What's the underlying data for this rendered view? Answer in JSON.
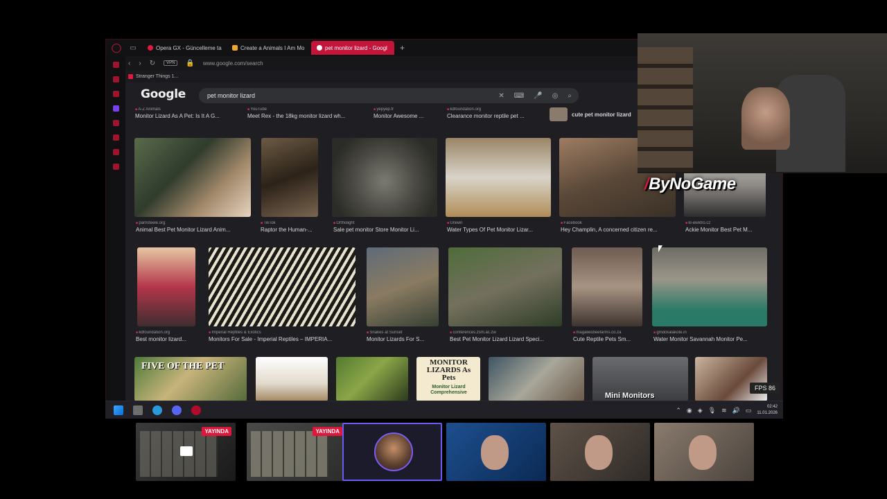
{
  "browser": {
    "tabs": [
      {
        "label": "Opera GX - Güncelleme ta",
        "active": false
      },
      {
        "label": "Create a Animals I Am Mo",
        "active": false
      },
      {
        "label": "pet monitor lizard - Googl",
        "active": true
      }
    ],
    "vpn_label": "VPN",
    "url": "www.google.com/search",
    "bookmark": "Stranger Things 1..."
  },
  "google": {
    "logo": "Google",
    "query": "pet monitor lizard",
    "top_captions": [
      {
        "source": "A-Z Animals",
        "title": "Monitor Lizard As A Pet: Is It A G..."
      },
      {
        "source": "YouTube",
        "title": "Meet Rex - the 18kg monitor lizard wh..."
      },
      {
        "source": "yepyep.fr",
        "title": "Monitor Awesome ..."
      },
      {
        "source": "kdfoundation.org",
        "title": "Clearance monitor reptile pet ..."
      }
    ],
    "related_chip": "cute pet monitor lizard",
    "row1": [
      {
        "source": "pamsteele.org",
        "title": "Animal Best Pet Monitor Lizard Anim..."
      },
      {
        "source": "TikTok",
        "title": "Raptor the Human-..."
      },
      {
        "source": "Ortholight",
        "title": "Sale pet monitor Store Monitor Li..."
      },
      {
        "source": "Uniwin",
        "title": "Water Types Of Pet Monitor Lizar..."
      },
      {
        "source": "Facebook",
        "title": "Hey Champlin, A concerned citizen re..."
      },
      {
        "source": "kl-elektro.cz",
        "title": "Ackie Monitor Best Pet M..."
      }
    ],
    "row2": [
      {
        "source": "kdfoundation.org",
        "title": "Best monitor lizard..."
      },
      {
        "source": "Imperial Reptiles & Exotics",
        "title": "Monitors For Sale - Imperial Reptiles – IMPERIA..."
      },
      {
        "source": "Snakes at Sunset",
        "title": "Monitor Lizards For S..."
      },
      {
        "source": "conferences.zsm.ac.zw",
        "title": "Best Pet Monitor Lizard Lizard Speci..."
      },
      {
        "source": "magaliesbeefarms.co.za",
        "title": "Cute Reptile Pets Sm..."
      },
      {
        "source": "gmdckalakote.in",
        "title": "Water Monitor Savannah Monitor Pe..."
      }
    ],
    "row3_texts": {
      "five": "FIVE OF THE PET",
      "book_title": "MONITOR LIZARDS As Pets",
      "book_sub": "Monitor Lizard Comprehensive",
      "mini": "Mini Monitors"
    }
  },
  "overlay": {
    "fps": "FPS 86",
    "brand": "ByNoGame",
    "live_label": "YAYINDA"
  },
  "taskbar": {
    "time": "02:42",
    "date": "11.01.2026"
  },
  "colors": {
    "accent": "#e01a3c",
    "active_tab": "#c5143a",
    "avatar_border": "#6a5cf2"
  }
}
